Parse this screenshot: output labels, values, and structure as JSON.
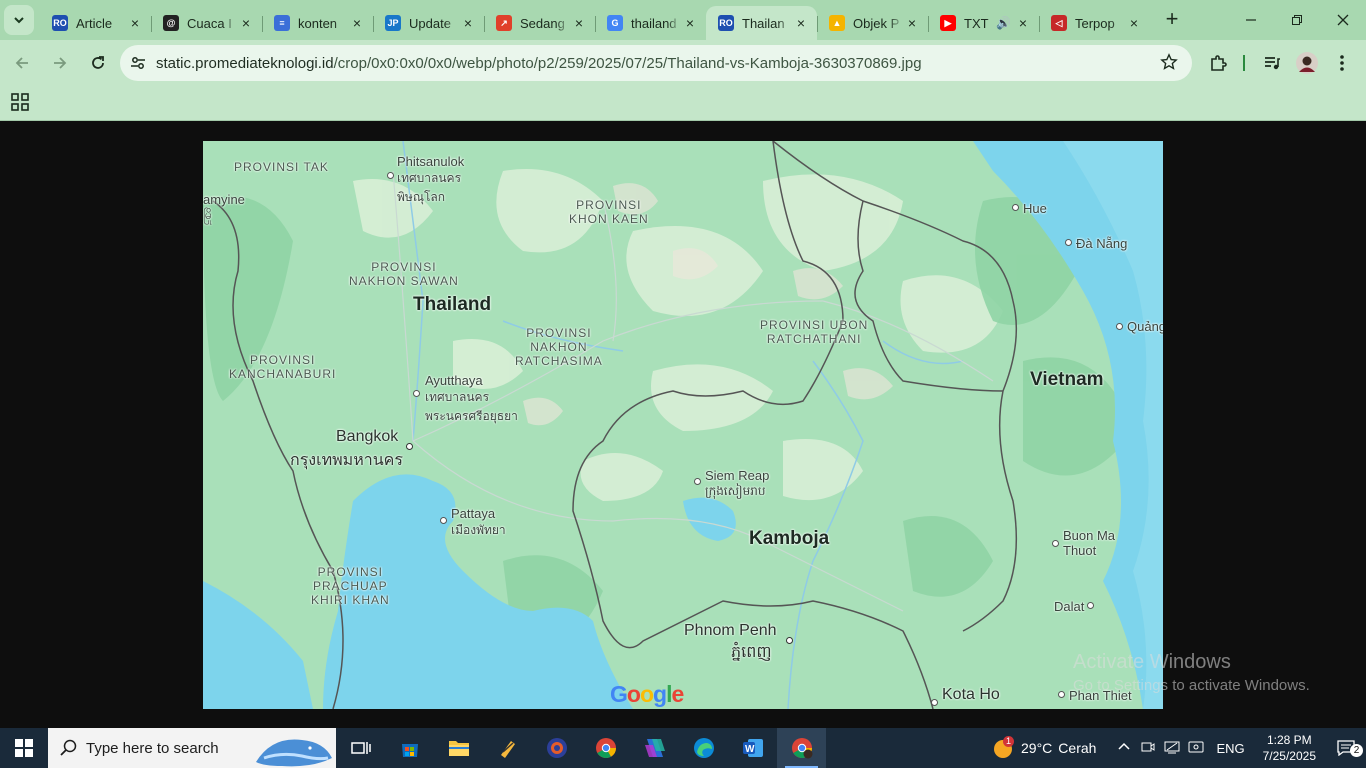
{
  "browser": {
    "tabs": [
      {
        "title": "Article",
        "icon": "ro-logo",
        "color": "#1e4fb0",
        "active": false
      },
      {
        "title": "Cuaca I",
        "icon": "openai-logo",
        "color": "#222222",
        "active": false
      },
      {
        "title": "konten",
        "icon": "google-docs-icon",
        "color": "#3b6fd8",
        "active": false
      },
      {
        "title": "Update",
        "icon": "jp-logo",
        "color": "#1877c9",
        "active": false
      },
      {
        "title": "Sedang",
        "icon": "trending-logo",
        "color": "#e0402a",
        "active": false
      },
      {
        "title": "thailand",
        "icon": "google-g-logo",
        "color": "#4285f4",
        "active": false
      },
      {
        "title": "Thailan",
        "icon": "ro-logo",
        "color": "#1e4fb0",
        "active": true
      },
      {
        "title": "Objek P",
        "icon": "drive-logo",
        "color": "#f4b400",
        "active": false
      },
      {
        "title": "TXT",
        "icon": "youtube-logo",
        "color": "#ff0000",
        "active": false,
        "audio": true
      },
      {
        "title": "Terpop",
        "icon": "terpopuler-logo",
        "color": "#c62828",
        "active": false
      }
    ],
    "close_glyph": "×",
    "new_tab_glyph": "+",
    "url": {
      "host": "static.promediateknologi.id",
      "path": "/crop/0x0:0x0/0x0/webp/photo/p2/259/2025/07/25/Thailand-vs-Kamboja-3630370869.jpg"
    }
  },
  "map": {
    "countries": [
      "Thailand",
      "Vietnam",
      "Kamboja"
    ],
    "provinces": [
      "PROVINSI TAK",
      "PROVINSI\nKHON KAEN",
      "PROVINSI\nNAKHON SAWAN",
      "PROVINSI UBON\nRATCHATHANI",
      "PROVINSI\nNAKHON\nRATCHASIMA",
      "PROVINSI\nKANCHANABURI",
      "PROVINSI\nPRACHUAP\nKHIRI KHAN"
    ],
    "cities": [
      {
        "name": "Phitsanulok",
        "script": "เทศบาลนคร\nพิษณุโลก"
      },
      {
        "name": "Ayutthaya",
        "script": "เทศบาลนคร\nพระนครศรีอยุธยา"
      },
      {
        "name": "Bangkok",
        "script": "กรุงเทพมหานคร"
      },
      {
        "name": "Pattaya",
        "script": "เมืองพัทยา"
      },
      {
        "name": "Siem Reap",
        "script": "ក្រុងសៀមរាប"
      },
      {
        "name": "Phnom Penh",
        "script": "ភ្នំពេញ"
      },
      {
        "name": "Hue",
        "script": ""
      },
      {
        "name": "Đà Nẵng",
        "script": ""
      },
      {
        "name": "Quảng",
        "script": ""
      },
      {
        "name": "Buon Ma\nThuot",
        "script": ""
      },
      {
        "name": "Dalat",
        "script": ""
      },
      {
        "name": "Kota Ho",
        "script": ""
      },
      {
        "name": "Phan Thiet",
        "script": ""
      },
      {
        "name": "amyine",
        "script": "မြို"
      }
    ],
    "attribution": "Google"
  },
  "watermark": {
    "title": "Activate Windows",
    "subtitle": "Go to Settings to activate Windows."
  },
  "taskbar": {
    "search_placeholder": "Type here to search",
    "weather": {
      "temp": "29°C",
      "condition": "Cerah",
      "badge": "1"
    },
    "language": "ENG",
    "time": "1:28 PM",
    "date": "7/25/2025",
    "notifications": "2"
  }
}
